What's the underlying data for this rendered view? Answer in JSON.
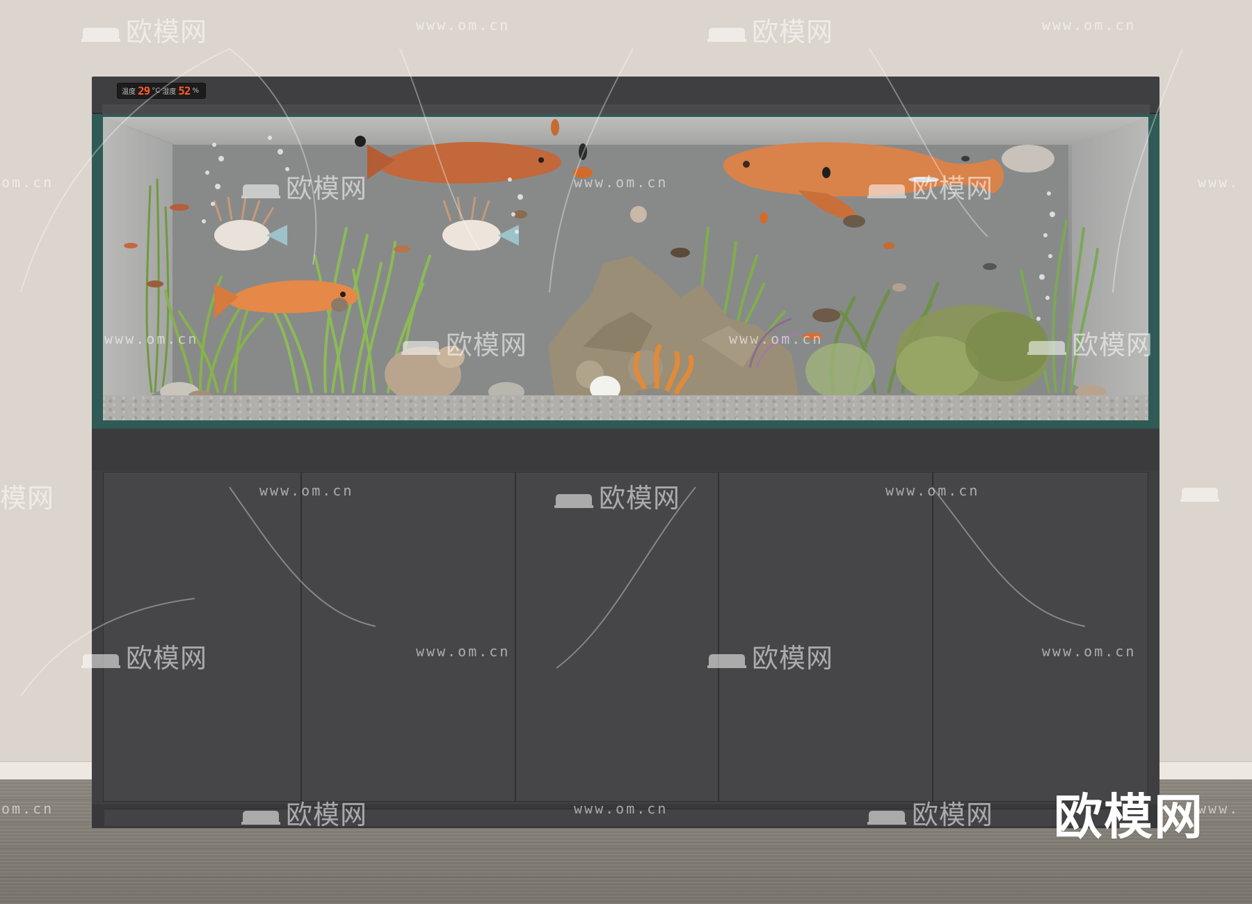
{
  "display": {
    "temp_label": "温度",
    "temp_value": "29",
    "temp_unit": "°C",
    "humidity_label": "湿度",
    "humidity_value": "52",
    "humidity_unit": "%"
  },
  "watermark": {
    "brand_text": "欧模网",
    "url_text": "www.om.cn",
    "url_fragment": "om.cn",
    "url_cut": "www.",
    "brand_fragment": "模网",
    "brand_large": "欧模网"
  },
  "colors": {
    "wall": "#dcd5cd",
    "floor": "#7f7a72",
    "cabinet": "#3f3f41",
    "tank_frame": "#2f5a56",
    "display_digits": "#ff5a2a",
    "arowana": "#d97a3e"
  }
}
